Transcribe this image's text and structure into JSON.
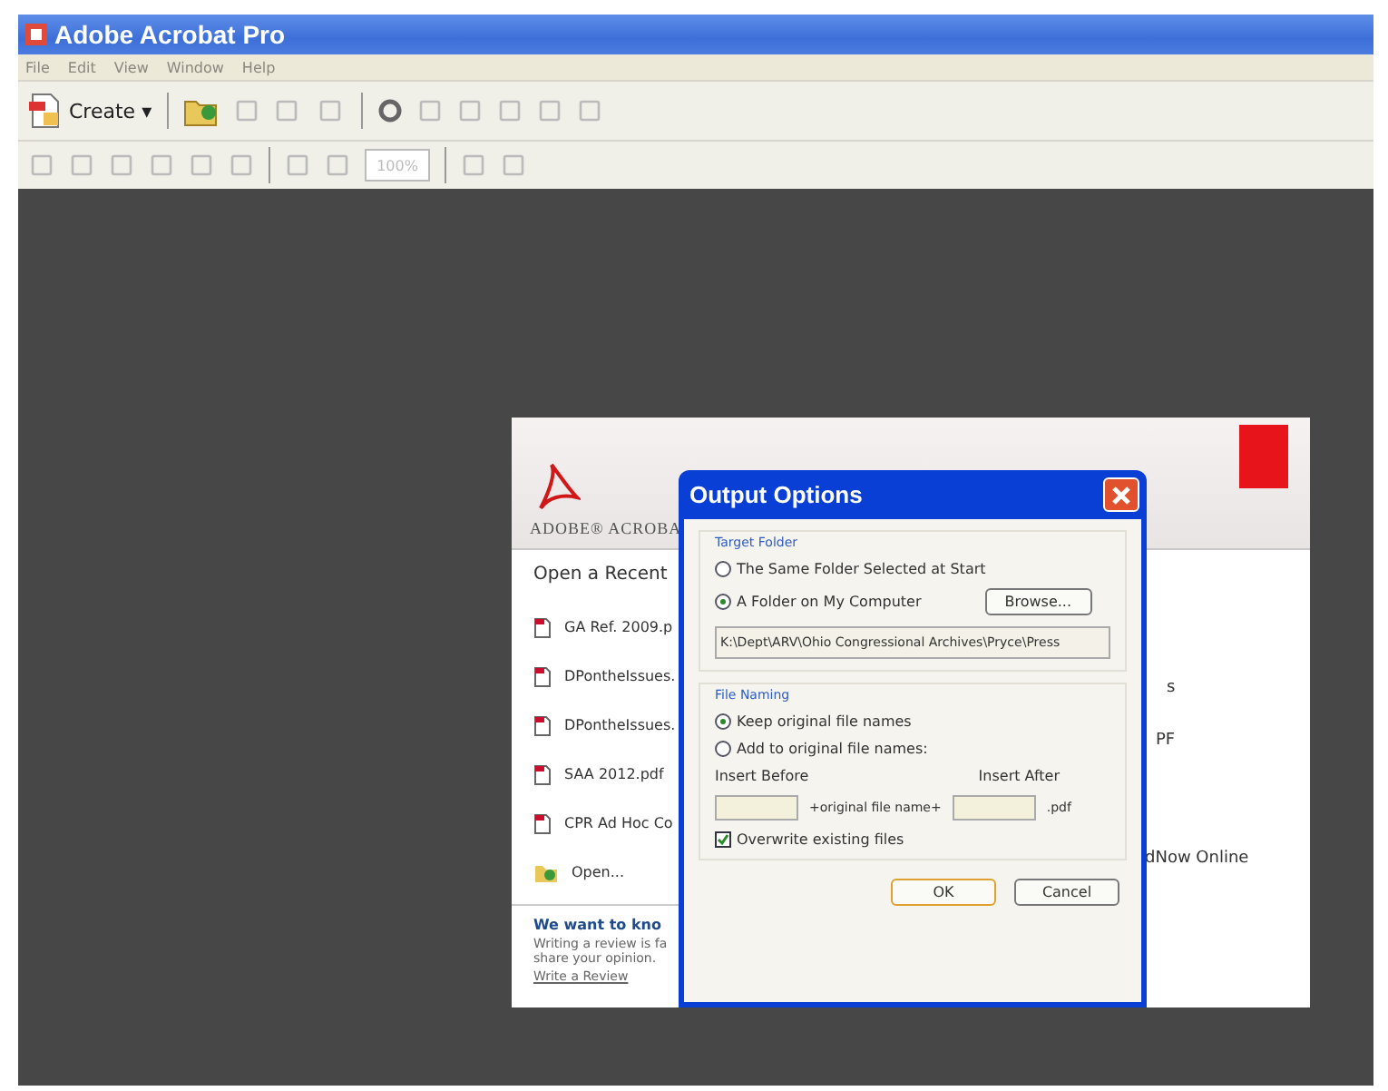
{
  "window": {
    "title": "Adobe Acrobat Pro"
  },
  "menu": [
    "File",
    "Edit",
    "View",
    "Window",
    "Help"
  ],
  "toolbar": {
    "create_label": "Create",
    "create_caret": "▾",
    "zoom_value": "100%"
  },
  "welcome": {
    "brand": "ADOBE® ACROBA",
    "recent_heading": "Open a Recent",
    "recent_files": [
      {
        "name": "GA Ref. 2009.p"
      },
      {
        "name": "DPontheIssues."
      },
      {
        "name": "DPontheIssues."
      },
      {
        "name": "SAA 2012.pdf"
      },
      {
        "name": "CPR Ad Hoc Co"
      }
    ],
    "open_label": "Open...",
    "review_heading": "We want to kno",
    "review_text": "Writing a review is fa share your opinion.",
    "review_link": "Write a Review",
    "right_texts": [
      "s",
      "PF",
      "dNow Online"
    ]
  },
  "dialog": {
    "title": "Output Options",
    "target_folder": {
      "legend": "Target Folder",
      "options": [
        {
          "label": "The Same Folder Selected at Start",
          "selected": false
        },
        {
          "label": "A Folder on My Computer",
          "selected": true
        }
      ],
      "browse": "Browse...",
      "path": "K:\\Dept\\ARV\\Ohio Congressional Archives\\Pryce\\Press"
    },
    "file_naming": {
      "legend": "File Naming",
      "options": [
        {
          "label": "Keep original file names",
          "selected": true
        },
        {
          "label": "Add to original file names:",
          "selected": false
        }
      ],
      "insert_before_label": "Insert Before",
      "insert_after_label": "Insert After",
      "middle": "+original file name+",
      "extension": ".pdf",
      "overwrite": {
        "label": "Overwrite existing files",
        "checked": true
      }
    },
    "buttons": [
      {
        "label": "OK",
        "default": true
      },
      {
        "label": "Cancel",
        "default": false
      }
    ]
  }
}
